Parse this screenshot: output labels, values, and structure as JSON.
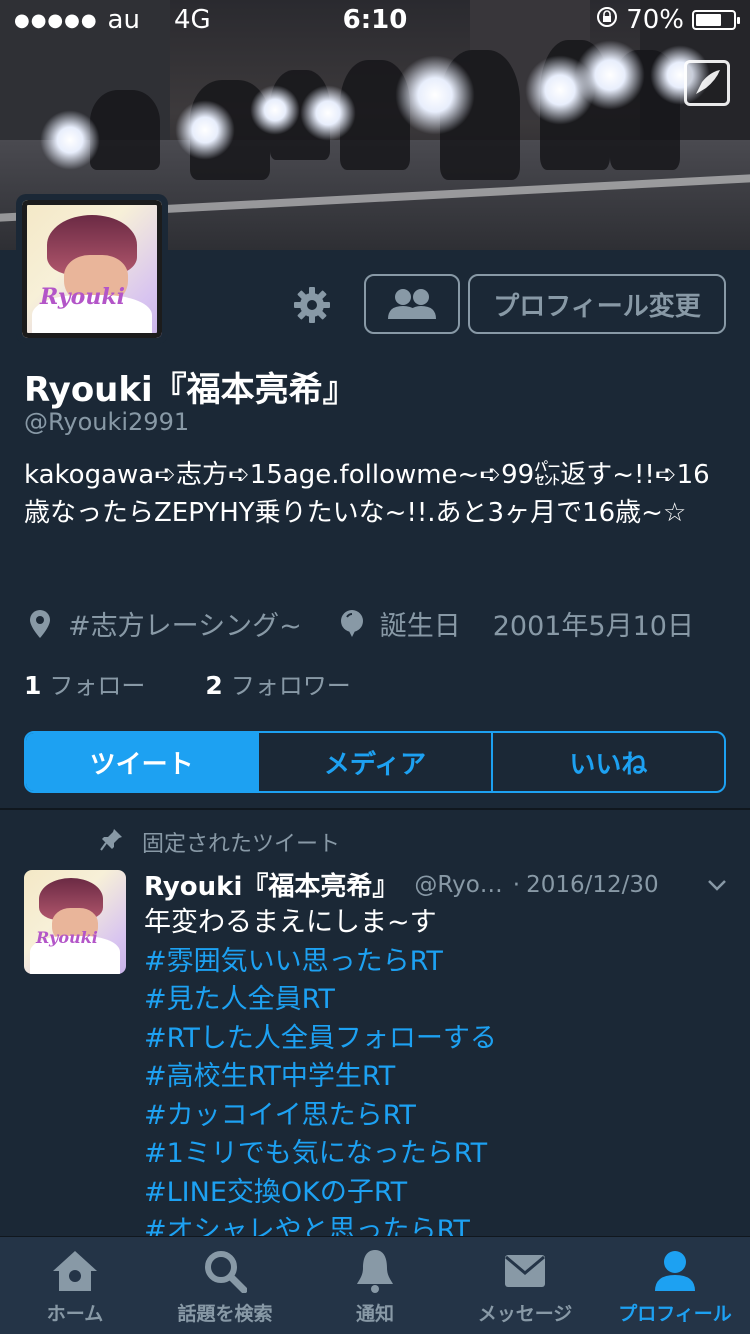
{
  "status_bar": {
    "signal": "●●●●●",
    "carrier": "au",
    "network": "4G",
    "time": "6:10",
    "battery_percent_text": "70%",
    "battery_level": 0.7
  },
  "profile": {
    "display_name": "Ryouki『福本亮希』",
    "handle": "@Ryouki2991",
    "avatar_signature": "Ryouki",
    "bio": "kakogawa➪志方➪15age.followme~➪99㌫返す~!!➪16歳なったらZEPYHY乗りたいな~!!.あと3ヶ月で16歳~☆",
    "location": "#志方レーシング~",
    "birthday_label": "誕生日",
    "birthday": "2001年5月10日",
    "following_count": "1",
    "following_label": "フォロー",
    "followers_count": "2",
    "followers_label": "フォロワー",
    "edit_profile_label": "プロフィール変更"
  },
  "tabs": [
    {
      "label": "ツイート",
      "active": true
    },
    {
      "label": "メディア",
      "active": false
    },
    {
      "label": "いいね",
      "active": false
    }
  ],
  "pinned_tweet": {
    "pinned_label": "固定されたツイート",
    "name": "Ryouki『福本亮希』",
    "handle": "@Ryo…",
    "separator": "·",
    "date": "2016/12/30",
    "text": "年変わるまえにしま~す",
    "hashtags": [
      "#雰囲気いい思ったらRT",
      "#見た人全員RT",
      "#RTした人全員フォローする",
      "#高校生RT中学生RT",
      "#カッコイイ思たらRT",
      "#1ミリでも気になったらRT",
      "#LINE交換OKの子RT",
      "#オシャレやと思ったらRT"
    ]
  },
  "tab_bar": [
    {
      "label": "ホーム",
      "icon": "home-icon",
      "active": false
    },
    {
      "label": "話題を検索",
      "icon": "search-icon",
      "active": false
    },
    {
      "label": "通知",
      "icon": "bell-icon",
      "active": false
    },
    {
      "label": "メッセージ",
      "icon": "envelope-icon",
      "active": false
    },
    {
      "label": "プロフィール",
      "icon": "person-icon",
      "active": true
    }
  ],
  "colors": {
    "accent": "#1da1f2",
    "background": "#1b2836",
    "secondary_text": "#8899a6",
    "tab_bar": "#243447"
  }
}
